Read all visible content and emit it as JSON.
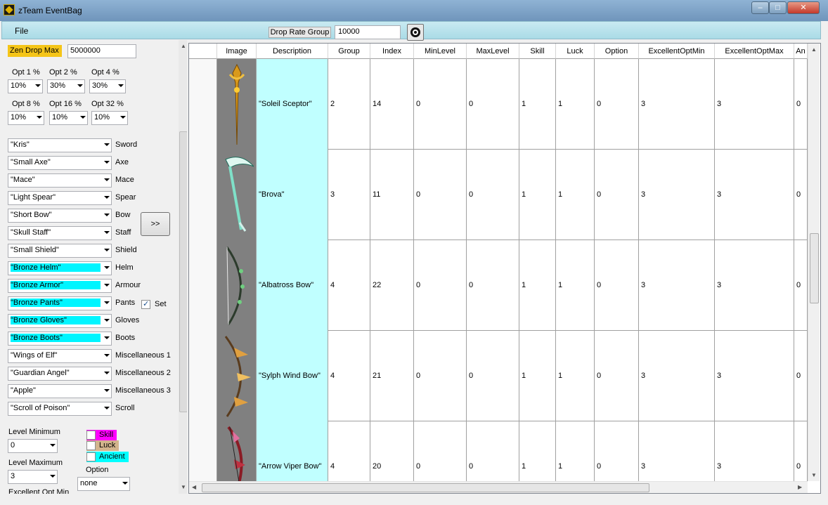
{
  "window": {
    "title": "zTeam EventBag",
    "min": "–",
    "max": "□",
    "close": "✕"
  },
  "menu": {
    "file": "File"
  },
  "toolbar": {
    "drop_rate_label": "Drop Rate Group",
    "drop_rate_value": "10000",
    "refresh_icon": "refresh-icon"
  },
  "left": {
    "zen_label": "Zen Drop Max",
    "zen_value": "5000000",
    "opts": [
      {
        "label": "Opt 1 %",
        "value": "10%"
      },
      {
        "label": "Opt 2 %",
        "value": "30%"
      },
      {
        "label": "Opt 4 %",
        "value": "30%"
      },
      {
        "label": "Opt 8 %",
        "value": "10%"
      },
      {
        "label": "Opt 16 %",
        "value": "10%"
      },
      {
        "label": "Opt 32 %",
        "value": "10%"
      }
    ],
    "items": [
      {
        "value": "\"Kris\"",
        "label": "Sword"
      },
      {
        "value": "\"Small Axe\"",
        "label": "Axe"
      },
      {
        "value": "\"Mace\"",
        "label": "Mace"
      },
      {
        "value": "\"Light Spear\"",
        "label": "Spear"
      },
      {
        "value": "\"Short Bow\"",
        "label": "Bow"
      },
      {
        "value": "\"Skull Staff\"",
        "label": "Staff"
      },
      {
        "value": "\"Small Shield\"",
        "label": "Shield"
      },
      {
        "value": "\"Bronze Helm\"",
        "label": "Helm"
      },
      {
        "value": "\"Bronze Armor\"",
        "label": "Armour"
      },
      {
        "value": "\"Bronze Pants\"",
        "label": "Pants"
      },
      {
        "value": "\"Bronze Gloves\"",
        "label": "Gloves"
      },
      {
        "value": "\"Bronze Boots\"",
        "label": "Boots"
      },
      {
        "value": "\"Wings of Elf\"",
        "label": "Miscellaneous 1"
      },
      {
        "value": "\"Guardian Angel\"",
        "label": "Miscellaneous 2"
      },
      {
        "value": "\"Apple\"",
        "label": "Miscellaneous 3"
      },
      {
        "value": "\"Scroll of Poison\"",
        "label": "Scroll"
      }
    ],
    "add_button": ">>",
    "set_label": "Set",
    "level_min_label": "Level Minimum",
    "level_min_value": "0",
    "level_max_label": "Level Maximum",
    "level_max_value": "3",
    "excellent_label": "Excellent Opt Min",
    "skill_label": "Skill",
    "luck_label": "Luck",
    "ancient_label": "Ancient",
    "option_label": "Option",
    "option_value": "none",
    "colors": {
      "zen": "#f5c518",
      "highlight": "#00f5ff",
      "skill": "#ff00ff",
      "luck": "#d2b48c",
      "ancient": "#00ffff"
    }
  },
  "grid": {
    "headers": [
      "Image",
      "Description",
      "Group",
      "Index",
      "MinLevel",
      "MaxLevel",
      "Skill",
      "Luck",
      "Option",
      "ExcellentOptMin",
      "ExcellentOptMax",
      "An"
    ],
    "rows": [
      {
        "description": "\"Soleil Sceptor\"",
        "group": "2",
        "index": "14",
        "minlevel": "0",
        "maxlevel": "0",
        "skill": "1",
        "luck": "1",
        "option": "0",
        "excmin": "3",
        "excmax": "3",
        "an": "0",
        "icon": "sceptre-icon"
      },
      {
        "description": "\"Brova\"",
        "group": "3",
        "index": "11",
        "minlevel": "0",
        "maxlevel": "0",
        "skill": "1",
        "luck": "1",
        "option": "0",
        "excmin": "3",
        "excmax": "3",
        "an": "0",
        "icon": "scythe-icon"
      },
      {
        "description": "\"Albatross Bow\"",
        "group": "4",
        "index": "22",
        "minlevel": "0",
        "maxlevel": "0",
        "skill": "1",
        "luck": "1",
        "option": "0",
        "excmin": "3",
        "excmax": "3",
        "an": "0",
        "icon": "bow-icon"
      },
      {
        "description": "\"Sylph Wind Bow\"",
        "group": "4",
        "index": "21",
        "minlevel": "0",
        "maxlevel": "0",
        "skill": "1",
        "luck": "1",
        "option": "0",
        "excmin": "3",
        "excmax": "3",
        "an": "0",
        "icon": "bow-icon"
      },
      {
        "description": "\"Arrow Viper Bow\"",
        "group": "4",
        "index": "20",
        "minlevel": "0",
        "maxlevel": "0",
        "skill": "1",
        "luck": "1",
        "option": "0",
        "excmin": "3",
        "excmax": "3",
        "an": "0",
        "icon": "bow-icon"
      }
    ]
  }
}
